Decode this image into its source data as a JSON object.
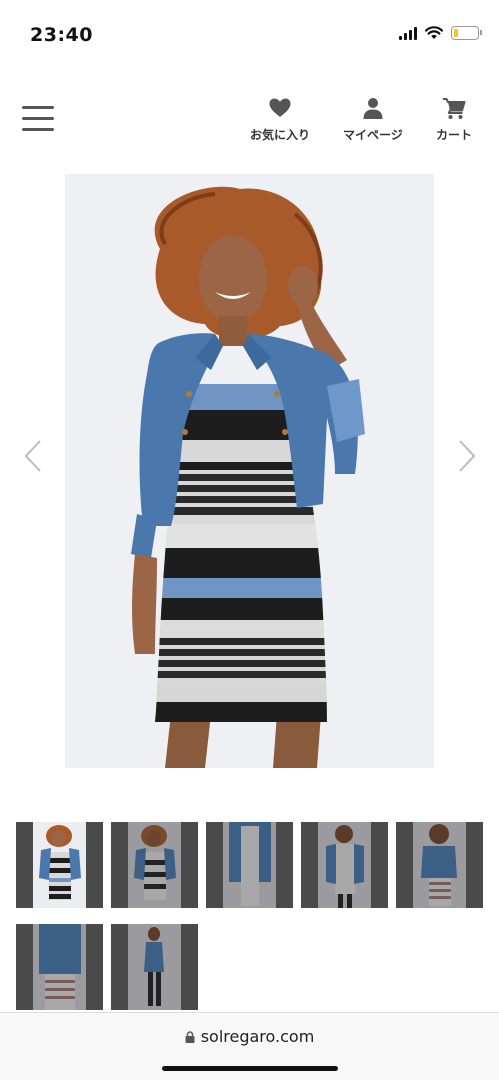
{
  "status_bar": {
    "time": "23:40",
    "icons": [
      "signal-icon",
      "wifi-icon",
      "battery-icon"
    ],
    "battery_level": 0.2
  },
  "header": {
    "menu_icon": "hamburger-menu-icon",
    "actions": [
      {
        "label": "お気に入り",
        "icon": "heart-icon"
      },
      {
        "label": "マイページ",
        "icon": "person-icon"
      },
      {
        "label": "カート",
        "icon": "cart-icon"
      }
    ]
  },
  "gallery": {
    "prev_icon": "chevron-left-icon",
    "next_icon": "chevron-right-icon",
    "thumbnail_count": 7
  },
  "browser": {
    "url": "solregaro.com",
    "lock_icon": "lock-icon"
  },
  "colors": {
    "icon_gray": "#555555",
    "denim": "#4a78ad",
    "stripe_blue": "#6f95c4",
    "stripe_black": "#1d1d1d",
    "stripe_gray": "#d8d8d8",
    "thumb_frame": "#4a4a4a"
  }
}
